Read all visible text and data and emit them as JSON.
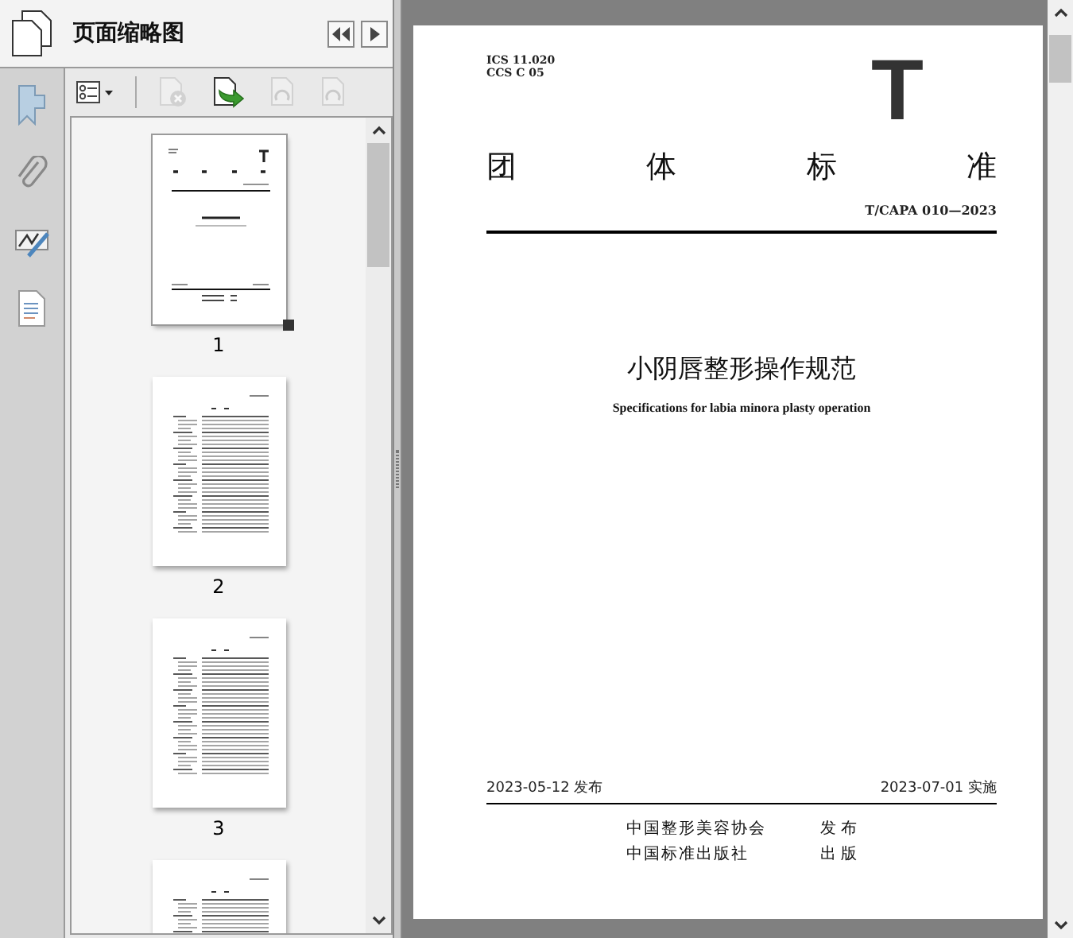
{
  "panel": {
    "title": "页面缩略图"
  },
  "toolbar": [
    {
      "kind": "options",
      "disabled": false
    },
    {
      "kind": "delete",
      "disabled": true
    },
    {
      "kind": "insert",
      "disabled": false
    },
    {
      "kind": "rotate",
      "disabled": true
    },
    {
      "kind": "rotate",
      "disabled": true
    }
  ],
  "thumbnails": [
    {
      "kind": "cover",
      "label": "1",
      "selected": true
    },
    {
      "kind": "contents",
      "label": "2",
      "selected": false
    },
    {
      "kind": "contents",
      "label": "3",
      "selected": false
    },
    {
      "kind": "contents",
      "selected": false
    }
  ],
  "document": {
    "ics": "ICS 11.020",
    "ccs": "CCS C 05",
    "logo_letter": "T",
    "heading": [
      "团",
      "体",
      "标",
      "准"
    ],
    "code": "T/CAPA 010—2023",
    "title": "小阴唇整形操作规范",
    "title_en": "Specifications for labia minora plasty operation",
    "issue_date": "2023-05-12 发布",
    "effective_date": "2023-07-01 实施",
    "publishers": [
      {
        "name": "中国整形美容协会",
        "role": "发 布"
      },
      {
        "name": "中国标准出版社",
        "role": "出 版"
      }
    ]
  }
}
